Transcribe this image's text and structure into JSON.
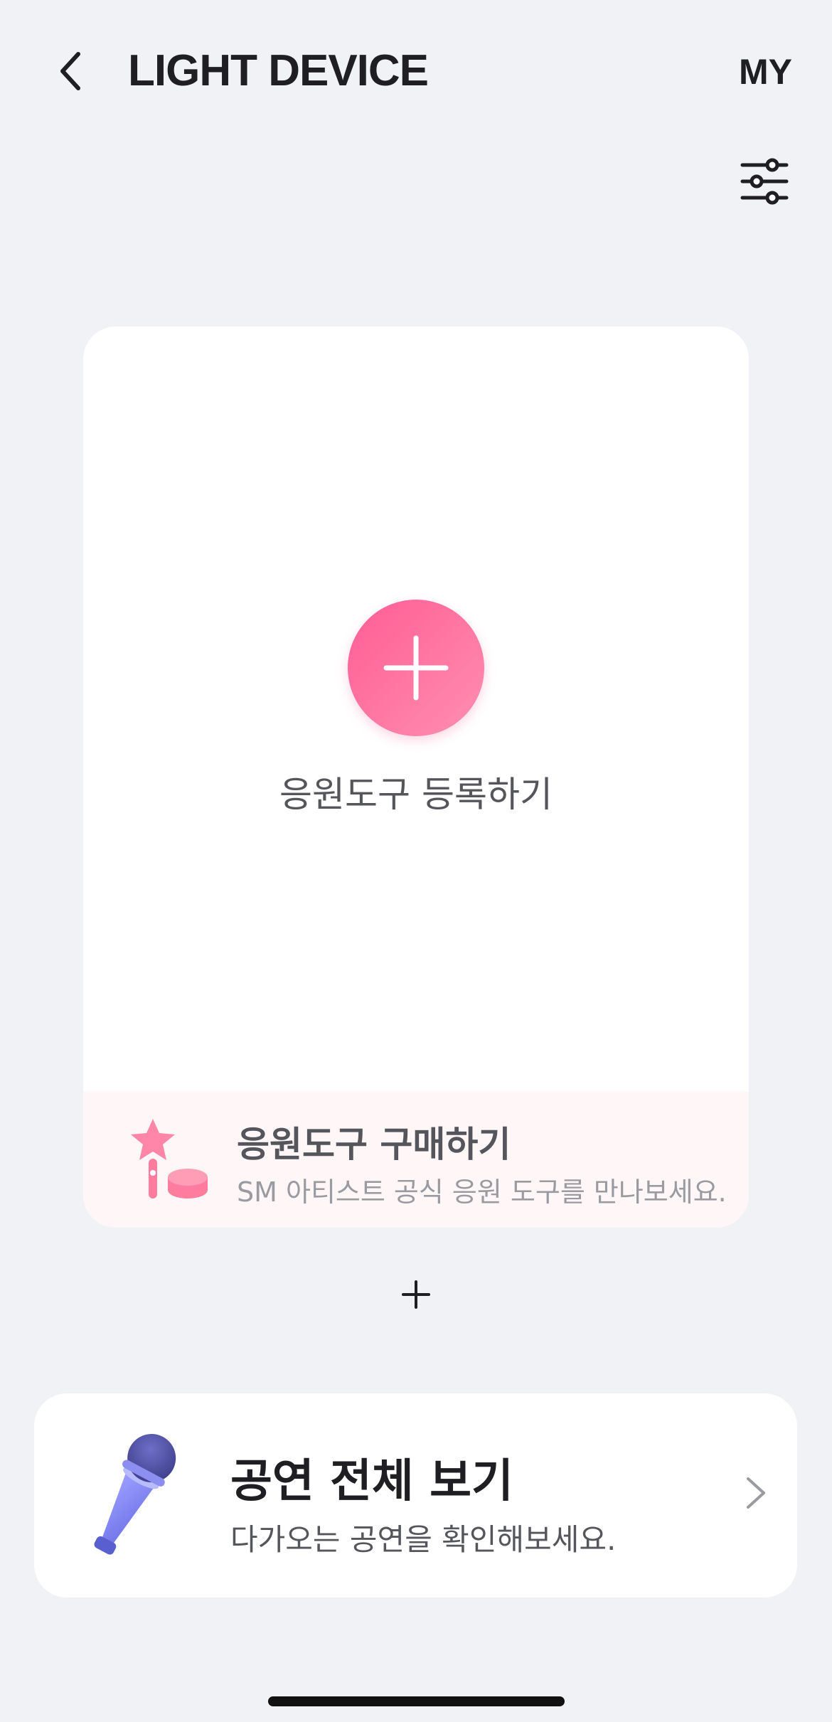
{
  "header": {
    "title": "LIGHT DEVICE",
    "my_label": "MY"
  },
  "card": {
    "register_label": "응원도구 등록하기",
    "purchase": {
      "title": "응원도구 구매하기",
      "subtitle": "SM 아티스트 공식 응원 도구를 만나보세요."
    }
  },
  "concerts": {
    "title": "공연 전체 보기",
    "subtitle": "다가오는 공연을 확인해보세요."
  },
  "icons": [
    "back-chevron-icon",
    "filter-sliders-icon",
    "plus-icon",
    "lightstick-icon",
    "microphone-icon",
    "chevron-right-icon"
  ],
  "colors": {
    "accent_pink": "#ff6a9a",
    "background": "#f1f2f6",
    "card": "#ffffff",
    "purchase_bg": "#fff6f8"
  }
}
